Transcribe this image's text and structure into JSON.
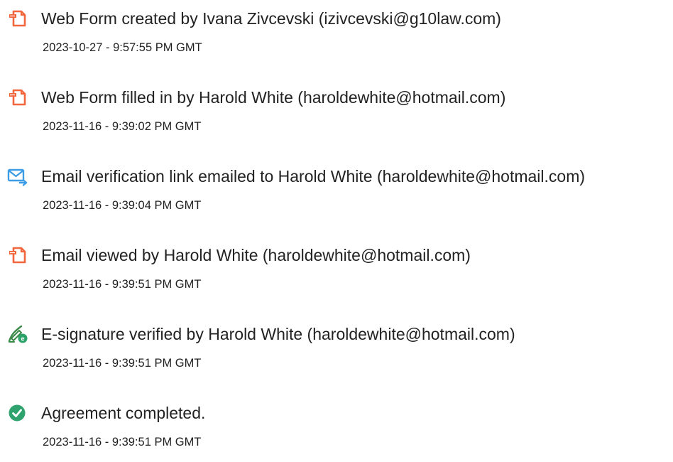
{
  "colors": {
    "document_icon": "#f2663e",
    "email_icon": "#3c9de6",
    "signature_icon": "#3c8a4a",
    "signature_badge": "#2aa368",
    "completed_icon": "#2ea36e"
  },
  "events": [
    {
      "icon": "document-icon",
      "text": "Web Form created by Ivana Zivcevski (izivcevski@g10law.com)",
      "time": "2023-10-27 - 9:57:55 PM GMT"
    },
    {
      "icon": "document-icon",
      "text": "Web Form filled in by Harold White (haroldewhite@hotmail.com)",
      "time": "2023-11-16 - 9:39:02 PM GMT"
    },
    {
      "icon": "email-sent-icon",
      "text": "Email verification link emailed to Harold White (haroldewhite@hotmail.com)",
      "time": "2023-11-16 - 9:39:04 PM GMT"
    },
    {
      "icon": "document-icon",
      "text": "Email viewed by Harold White (haroldewhite@hotmail.com)",
      "time": "2023-11-16 - 9:39:51 PM GMT"
    },
    {
      "icon": "e-signature-icon",
      "text": "E-signature verified by Harold White (haroldewhite@hotmail.com)",
      "time": "2023-11-16 - 9:39:51 PM GMT"
    },
    {
      "icon": "checkmark-circle-icon",
      "text": "Agreement completed.",
      "time": "2023-11-16 - 9:39:51 PM GMT"
    }
  ]
}
